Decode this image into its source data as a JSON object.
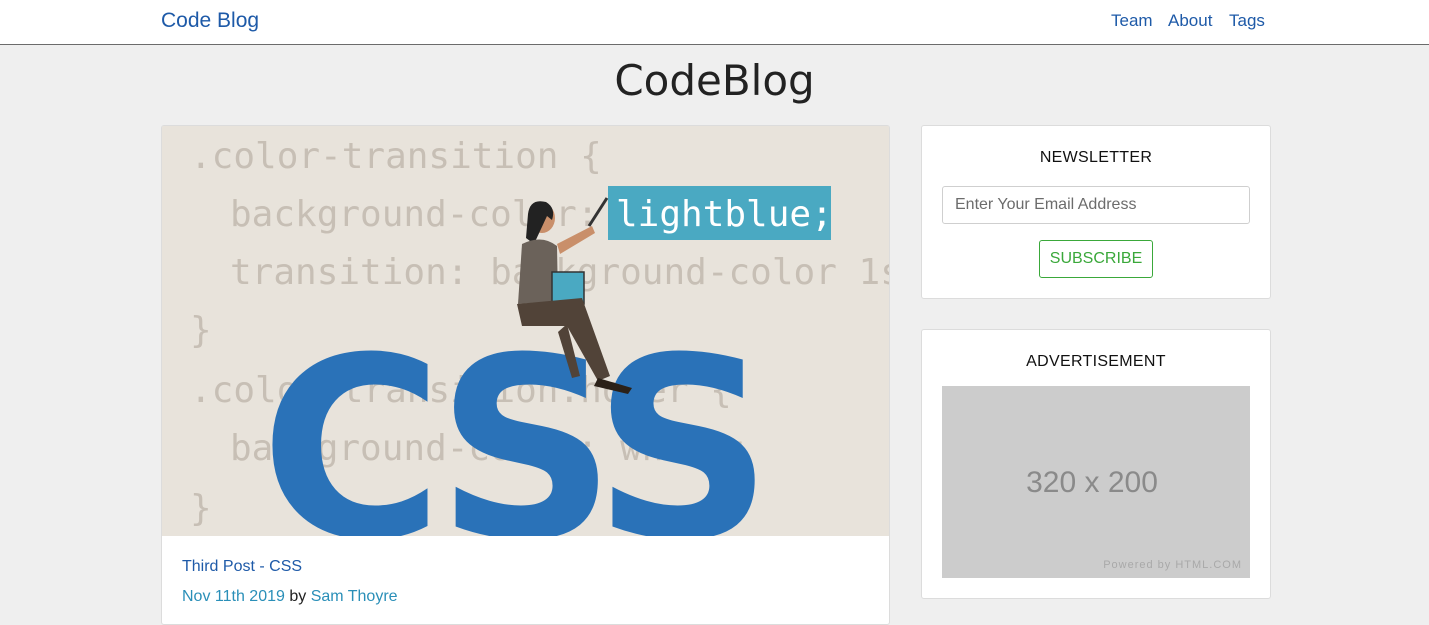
{
  "navbar": {
    "brand": "Code Blog",
    "links": [
      "Team",
      "About",
      "Tags"
    ]
  },
  "site_title": "CodeBlog",
  "post": {
    "image": {
      "code_lines": [
        ".color-transition {",
        "background-color:",
        "lightblue;",
        "transition: background-color 1s",
        "}",
        ".color-transition:hover {",
        "background-color: white;",
        "}"
      ],
      "big_text": "CSS"
    },
    "title": "Third Post - CSS",
    "date": "Nov 11th 2019",
    "by": "by",
    "author": "Sam Thoyre"
  },
  "newsletter": {
    "heading": "NEWSLETTER",
    "placeholder": "Enter Your Email Address",
    "button": "SUBSCRIBE"
  },
  "advertisement": {
    "heading": "ADVERTISEMENT",
    "size_text": "320 x 200",
    "powered": "Powered by HTML.COM"
  },
  "colors": {
    "link": "#1e5aa8",
    "accent_teal": "#2a8fb8",
    "success": "#3aa83a",
    "css_blue": "#2a72b8",
    "highlight": "#4aa9c2"
  }
}
